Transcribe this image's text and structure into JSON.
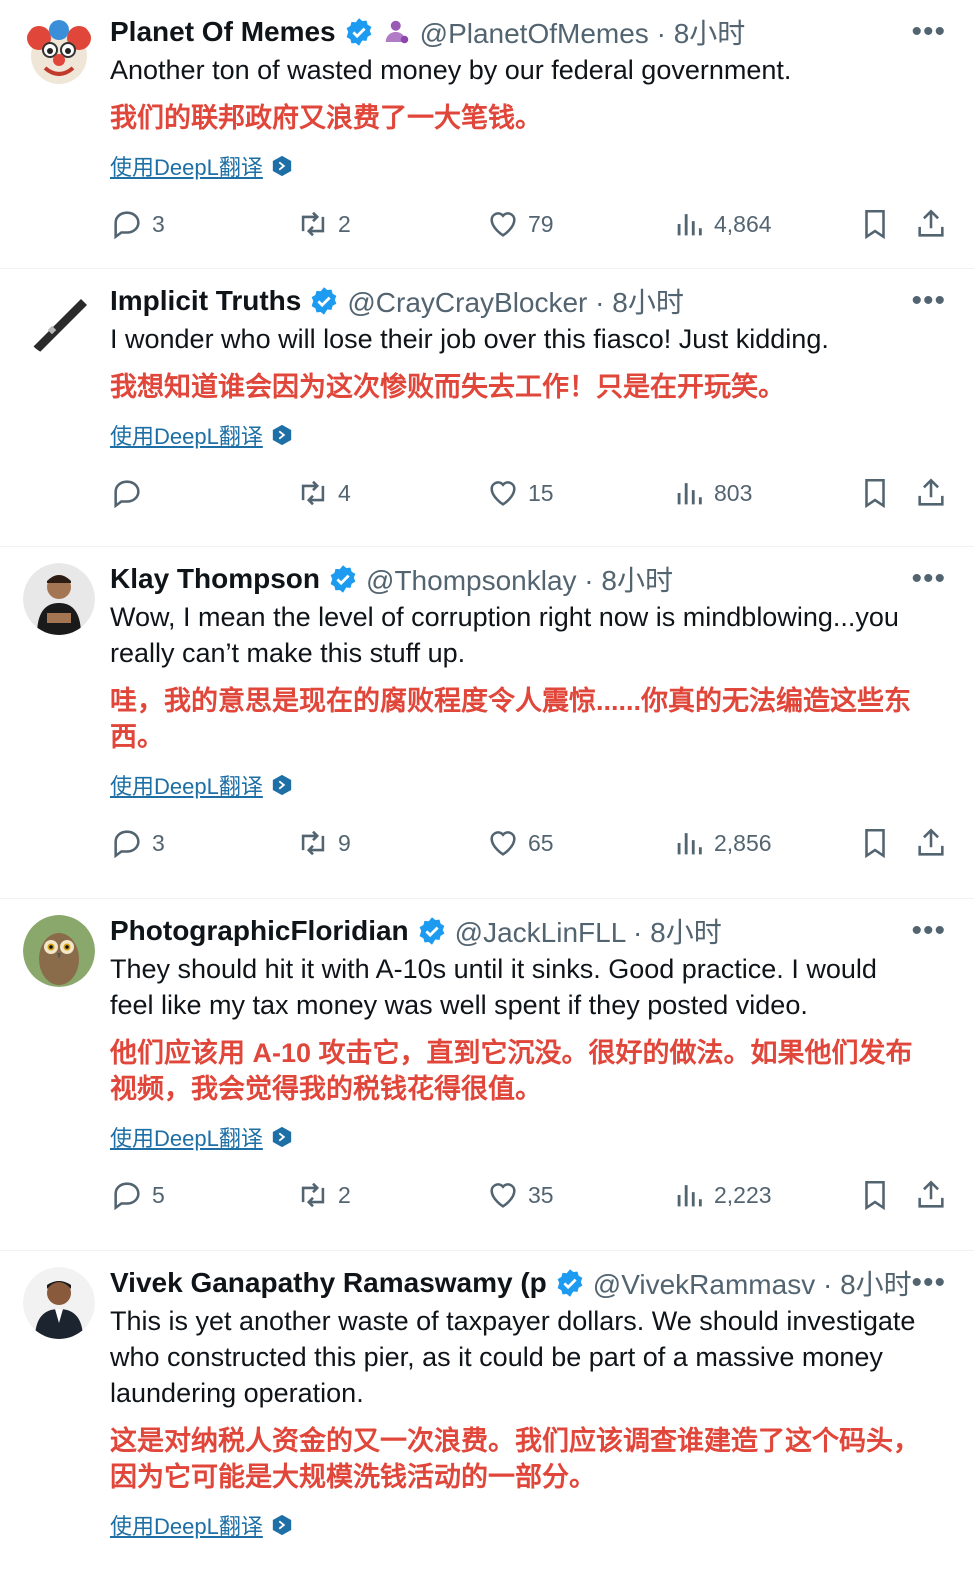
{
  "tweets": [
    {
      "name": "Planet Of Memes",
      "handle": "@PlanetOfMemes · 8小时",
      "avatar": "clown-emoji-avatar",
      "badge": "affiliate-person-icon",
      "text_en": "Another ton of wasted money by our federal government.",
      "text_zh": "我们的联邦政府又浪费了一大笔钱。",
      "translate": "使用DeepL翻译",
      "replies": "3",
      "retweets": "2",
      "likes": "79",
      "views": "4,864"
    },
    {
      "name": "Implicit Truths",
      "handle": "@CrayCrayBlocker · 8小时",
      "avatar": "pen-avatar",
      "text_en": "I wonder who will lose their job over this fiasco! Just kidding.",
      "text_zh": "我想知道谁会因为这次惨败而失去工作！只是在开玩笑。",
      "translate": "使用DeepL翻译",
      "replies": "",
      "retweets": "4",
      "likes": "15",
      "views": "803"
    },
    {
      "name": "Klay Thompson",
      "handle": "@Thompsonklay · 8小时",
      "avatar": "man-photo-avatar",
      "text_en": "Wow, I mean the level of corruption right now is mindblowing...you really can’t make this stuff up.",
      "text_zh": "哇，我的意思是现在的腐败程度令人震惊......你真的无法编造这些东西。",
      "translate": "使用DeepL翻译",
      "replies": "3",
      "retweets": "9",
      "likes": "65",
      "views": "2,856"
    },
    {
      "name": "PhotographicFloridian",
      "handle": "@JackLinFLL · 8小时",
      "avatar": "owl-photo-avatar",
      "text_en": "They should hit it with A-10s until it sinks. Good practice. I would feel like my tax money was well spent if they posted video.",
      "text_zh": "他们应该用 A-10 攻击它，直到它沉没。很好的做法。如果他们发布视频，我会觉得我的税钱花得很值。",
      "translate": "使用DeepL翻译",
      "replies": "5",
      "retweets": "2",
      "likes": "35",
      "views": "2,223"
    },
    {
      "name": "Vivek Ganapathy Ramaswamy (p",
      "handle": "@VivekRammasv · 8小时",
      "avatar": "man-suit-photo-avatar",
      "text_en": "This is yet another waste of taxpayer dollars. We should investigate who constructed this pier, as it could be part of a massive money laundering operation.",
      "text_zh": "这是对纳税人资金的又一次浪费。我们应该调查谁建造了这个码头，因为它可能是大规模洗钱活动的一部分。",
      "translate": "使用DeepL翻译"
    }
  ],
  "colors": {
    "verified": "#1d9bf0",
    "translation_text": "#e0463a",
    "link": "#1d6fa5",
    "secondary": "#536471"
  },
  "icons": {
    "more": "more-dots-icon",
    "reply": "reply-icon",
    "retweet": "retweet-icon",
    "like": "heart-icon",
    "views": "views-bar-icon",
    "bookmark": "bookmark-icon",
    "share": "share-icon",
    "deepl": "deepl-icon"
  }
}
